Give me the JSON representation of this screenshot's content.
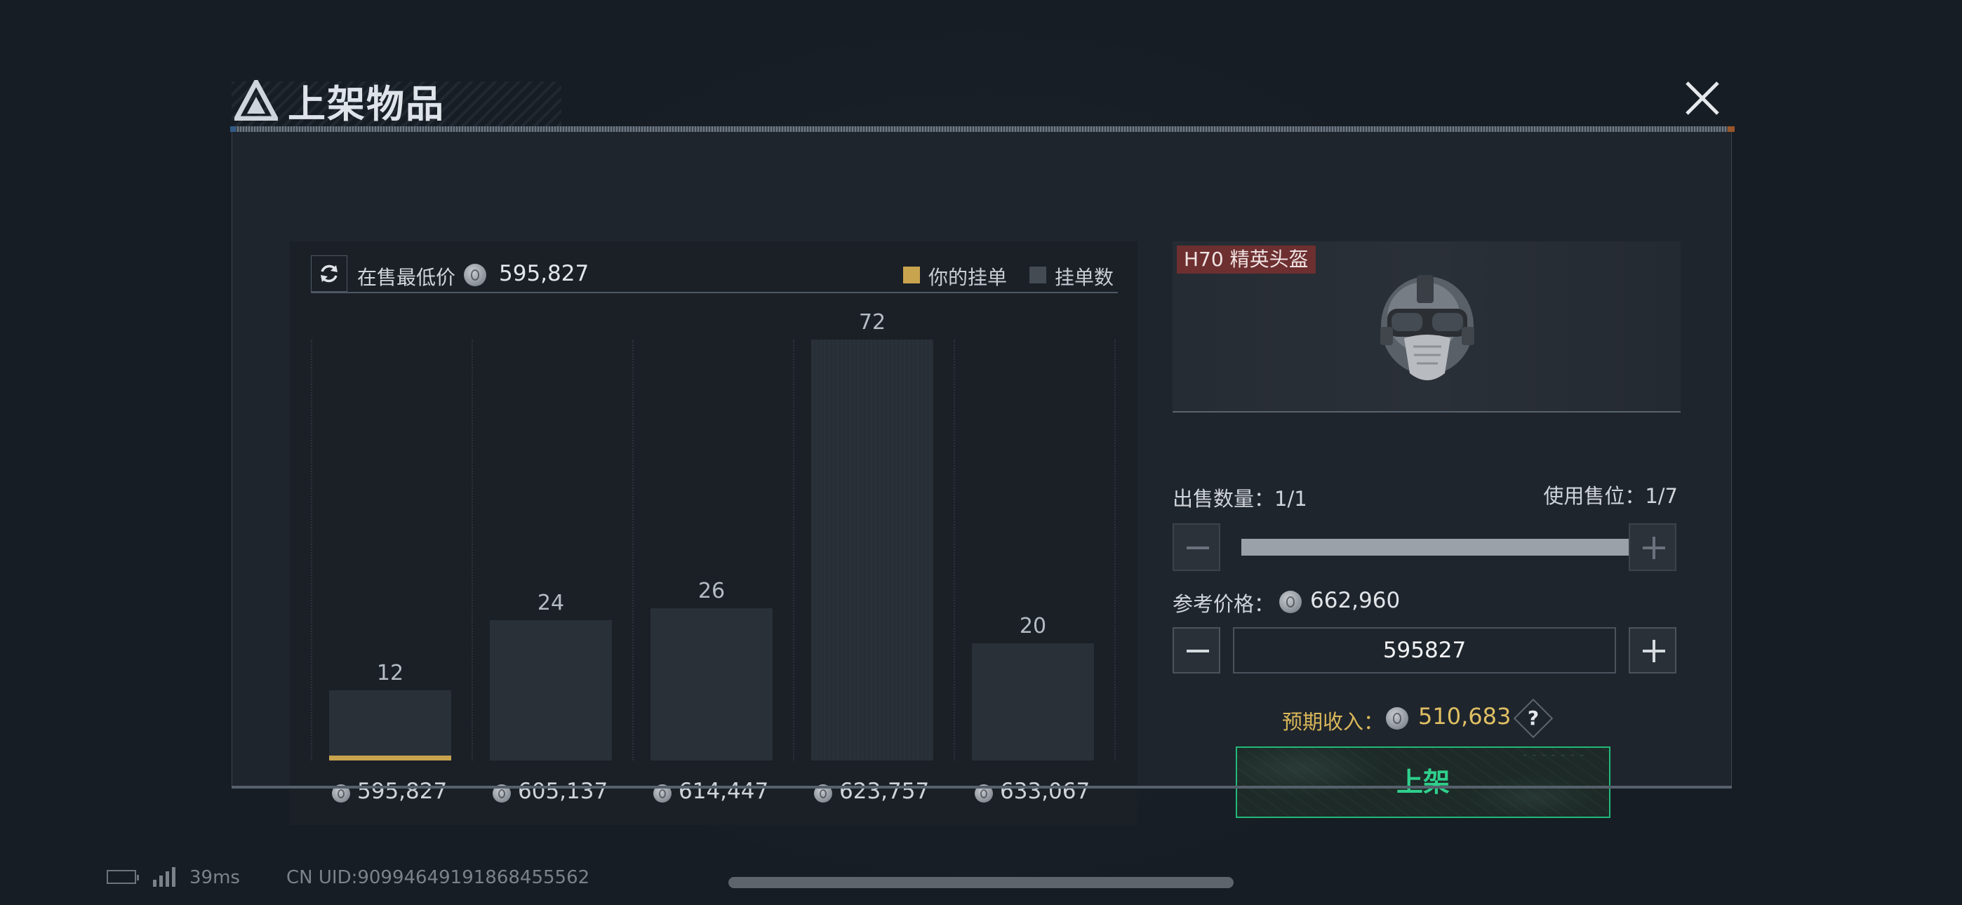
{
  "dialog": {
    "title": "上架物品",
    "close_icon": "close-icon"
  },
  "chart_panel": {
    "lowest_label": "在售最低价",
    "lowest_value": "595,827",
    "legend_mine": "你的挂单",
    "legend_count": "挂单数",
    "colors": {
      "mine": "#c9a44f",
      "count": "#444b53"
    }
  },
  "chart_data": {
    "type": "bar",
    "categories": [
      "595,827",
      "605,137",
      "614,447",
      "623,757",
      "633,067"
    ],
    "values": [
      12,
      24,
      26,
      72,
      20
    ],
    "value_labels": [
      "12",
      "24",
      "26",
      "72",
      "20"
    ],
    "series": [
      {
        "name": "挂单数",
        "values": [
          12,
          24,
          26,
          72,
          20
        ]
      }
    ],
    "your_listing_category": "595,827",
    "title": "",
    "xlabel": "",
    "ylabel": "",
    "ylim": [
      0,
      72
    ]
  },
  "item": {
    "tag": "H70 精英头盔",
    "image": "helmet-icon"
  },
  "quantity": {
    "label": "出售数量：1/1",
    "slots_label": "使用售位：1/7",
    "level": 1.0
  },
  "pricing": {
    "reference_label": "参考价格：",
    "reference_value": "662,960",
    "input_value": "595827",
    "income_label": "预期收入：",
    "income_value": "510,683",
    "help_label": "?",
    "submit_label": "上架"
  },
  "status_bar": {
    "ping": "39ms",
    "uid": "CN UID:90994649191868455562"
  }
}
